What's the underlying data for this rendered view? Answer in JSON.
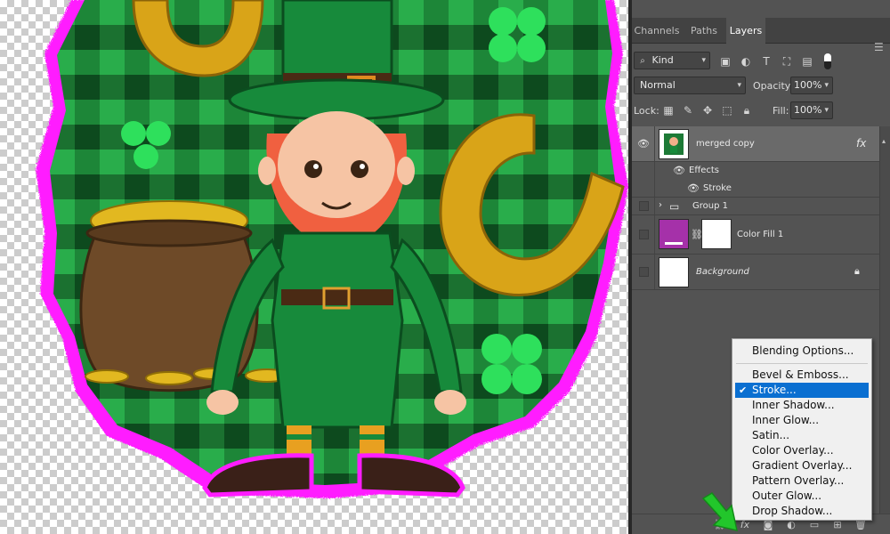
{
  "panel": {
    "tabs": [
      {
        "label": "Channels"
      },
      {
        "label": "Paths"
      },
      {
        "label": "Layers"
      }
    ],
    "active_tab": "Layers",
    "filter": {
      "value": "Kind"
    },
    "blend_mode": {
      "value": "Normal"
    },
    "opacity": {
      "label": "Opacity:",
      "value": "100%"
    },
    "lock": {
      "label": "Lock:"
    },
    "fill": {
      "label": "Fill:",
      "value": "100%"
    }
  },
  "layers": [
    {
      "name": "merged copy",
      "fx": "fx",
      "visible": true,
      "selected": true
    },
    {
      "name": "Effects"
    },
    {
      "name": "Stroke"
    },
    {
      "name": "Group 1"
    },
    {
      "name": "Color Fill 1",
      "fill_color": "#a531a9"
    },
    {
      "name": "Background",
      "locked": true
    }
  ],
  "fx_menu": {
    "items": [
      {
        "label": "Blending Options..."
      },
      {
        "label": "Bevel & Emboss..."
      },
      {
        "label": "Stroke...",
        "checked": true,
        "highlighted": true
      },
      {
        "label": "Inner Shadow..."
      },
      {
        "label": "Inner Glow..."
      },
      {
        "label": "Satin..."
      },
      {
        "label": "Color Overlay..."
      },
      {
        "label": "Gradient Overlay..."
      },
      {
        "label": "Pattern Overlay..."
      },
      {
        "label": "Outer Glow..."
      },
      {
        "label": "Drop Shadow..."
      }
    ]
  },
  "colors": {
    "panel_bg": "#535353",
    "highlight": "#0a6fd1",
    "stroke_magenta": "#ff00ff",
    "arrow_green": "#22c62b",
    "plaid_green": "#1f8f3c"
  },
  "icons": [
    "eye-icon",
    "folder-icon",
    "link-icon",
    "lock-icon",
    "fx-icon",
    "panel-menu-icon",
    "search-icon",
    "trash-icon"
  ]
}
